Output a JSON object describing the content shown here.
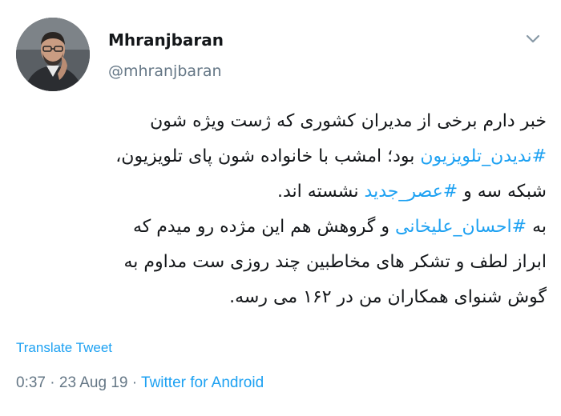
{
  "tweet": {
    "author": {
      "display_name": "Mhranjbaran",
      "handle": "@mhranjbaran"
    },
    "body": {
      "line1": "خبر دارم برخی از مدیران کشوری که ژست ویژه شون",
      "line2_hashtag": "#ندیدن_تلویزیون",
      "line2_rest": " بود؛ امشب با خانواده شون پای تلویزیون،",
      "line3_a": "شبکه سه و ",
      "line3_hashtag": "#عصر_جدید",
      "line3_b": " نشسته اند.",
      "line4_a": "به ",
      "line4_hashtag": "#احسان_علیخانی",
      "line4_b": " و گروهش هم این مژده رو میدم که",
      "line5": "ابراز لطف و تشکر های مخاطبین چند روزی ست مداوم به",
      "line6": "گوش شنوای همکاران من در ۱۶۲ می رسه."
    },
    "translate_label": "Translate Tweet",
    "time": "0:37",
    "separator": " · ",
    "date": "23 Aug 19",
    "source": "Twitter for Android"
  },
  "colors": {
    "link": "#1da1f2",
    "muted": "#657786",
    "text": "#14171a"
  },
  "icons": {
    "more": "chevron-down-icon"
  }
}
